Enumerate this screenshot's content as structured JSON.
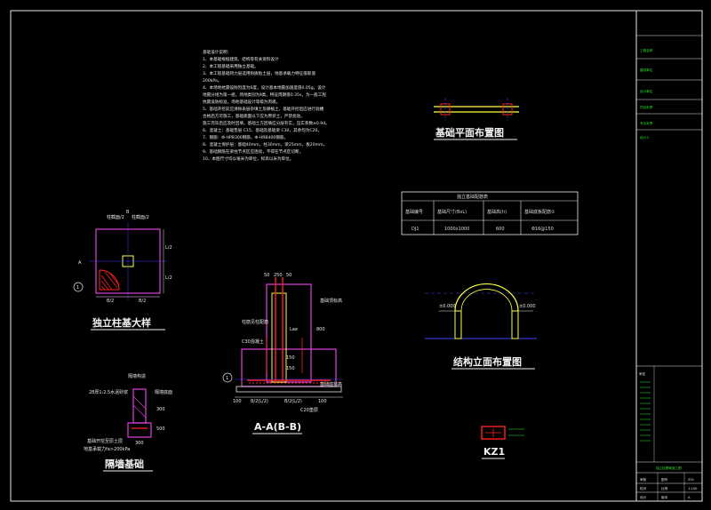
{
  "notes": {
    "heading": "基础设计说明：",
    "lines": [
      "1、本基础根据建筑、结构等有关资料设计",
      "2、本工程基础采用独立基础。",
      "3、本工程基础持力层选用粉质粘土层，地基承载力特征值取值",
      "200kPa。",
      "4、本场地抗震设防烈度为6度，设计基本地震加速度值0.05g，设计",
      "地震分组为第一组，场地类别为Ⅱ类，特征周期值0.35s，为一般工程",
      "抗震设防标准，场地基础设计等级为丙级。",
      "5、基础开挖前应清除表层杂填土及耕植土，基础开挖后应进行验槽",
      "合格后方可施工，基础底面以下应为原状土，严禁扰动。",
      "施工完毕后应及时回填，基础土方回填应分层夯实，压实系数≥0.94。",
      "6、混凝土：基础垫层 C15，基础及基础梁 C30，其余均为C20。",
      "7、钢筋：Φ-HPB300钢筋，Φ-HRB400钢筋。",
      "8、混凝土保护层：基础40mm，柱30mm，梁25mm，板20mm。",
      "9、基础钢筋在梁柱节点区应连续，不得在节点区切断。",
      "10、本图尺寸均以毫米为单位，标高以米为单位。"
    ]
  },
  "views": {
    "plan_title": "基础平面布置图",
    "elevation_title": "结构立面布置图",
    "footing_title": "独立柱基大样",
    "section_title": "A-A(B-B)",
    "wall_title": "隔墙基础",
    "column_title": "KZ1"
  },
  "footing_table": {
    "caption": "独立基础配筋表",
    "headers": [
      "基础编号",
      "基础尺寸(BxL)",
      "基础高(h)",
      "基础底板配筋①"
    ],
    "rows": [
      [
        "DJ1",
        "1000x1000",
        "600",
        "Φ16@150"
      ]
    ]
  },
  "footing_plan": {
    "dims": [
      "B/2",
      "B/2",
      "L/2",
      "L/2"
    ],
    "col_labels": [
      "柱截面/2",
      "柱截面/2"
    ],
    "grid_labels": [
      "B",
      "A"
    ],
    "rebar_mark": "1"
  },
  "section": {
    "dims_top": [
      "50",
      "250",
      "50"
    ],
    "dims_bottom": [
      "100",
      "B/2(L/2)",
      "B/2(L/2)",
      "100"
    ],
    "heights": [
      "800",
      "150",
      "150"
    ],
    "labels": {
      "col_reinf": "柱筋见柱配筋",
      "concrete_col": "C30混凝土",
      "concrete_pad": "C20垫层",
      "bottom_elev": "基础底标高",
      "top_elev": "基础顶标高",
      "sand": "砂石垫层",
      "anchor": "Lae"
    },
    "rebar_mark": "1"
  },
  "wall_footing": {
    "labels": [
      "隔墙构造",
      "28厚1:2.5水泥砂浆",
      "隔墙底面",
      "基础开挖至原土层",
      "地基承载力fa>200kPa"
    ],
    "dims": [
      "300",
      "500",
      "300"
    ]
  },
  "elevation": {
    "labels": [
      "±0.000",
      "±0.000"
    ]
  },
  "title_block": {
    "rows_top": [
      "工程名称",
      "建设单位",
      "设计单位",
      "项目负责",
      "专业负责",
      "设计人"
    ],
    "rows_bottom": [
      "审定",
      "审核",
      "校对",
      "设计",
      "制图",
      "日期",
      "图号",
      "比例",
      "版本"
    ],
    "drawing_name": "独立柱基础施工图",
    "code_values": [
      "Z01",
      "1:100",
      "A"
    ]
  },
  "colors": {
    "background": "#000000",
    "border": "#e8e8e8",
    "rebar": "#ff2020",
    "outline": "#e040e0",
    "dimension": "#e8e8e8",
    "accent_green": "#2ee62e",
    "accent_yellow": "#ffff40",
    "accent_cyan": "#40e0ff",
    "axis_blue": "#4040ff"
  }
}
